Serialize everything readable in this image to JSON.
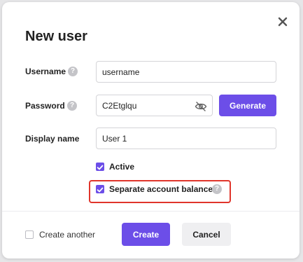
{
  "dialog": {
    "title": "New user"
  },
  "form": {
    "username": {
      "label": "Username",
      "value": "username"
    },
    "password": {
      "label": "Password",
      "value": "C2Etglqu",
      "generate_label": "Generate"
    },
    "display_name": {
      "label": "Display name",
      "value": "User 1"
    },
    "active": {
      "label": "Active",
      "checked": true
    },
    "separate_balance": {
      "label": "Separate account balance",
      "checked": true
    }
  },
  "footer": {
    "create_another_label": "Create another",
    "create_label": "Create",
    "cancel_label": "Cancel"
  },
  "help_glyph": "?",
  "icons": [
    "close-icon",
    "help-icon",
    "eye-off-icon",
    "check-icon"
  ],
  "colors": {
    "accent": "#6c4ee8",
    "highlight": "#e0352b"
  }
}
